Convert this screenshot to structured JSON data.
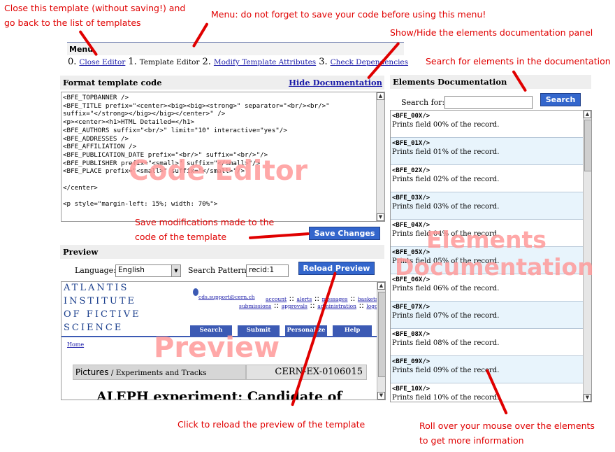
{
  "annotations": {
    "close_template": [
      "Close this template (without saving!) and",
      "go back to the list of templates"
    ],
    "menu_note": "Menu: do not forget to save your code before using this menu!",
    "show_hide_docs": "Show/Hide the elements documentation panel",
    "search_docs": "Search for elements in the documentation",
    "save_note": [
      "Save modifications made to the",
      "code of the template"
    ],
    "reload_note": "Click to reload the preview of the template",
    "rollover_note": [
      "Roll over your mouse over the elements",
      "to get more information"
    ],
    "code_editor_overlay": "Code Editor",
    "docs_overlay_1": "Elements",
    "docs_overlay_2": "Documentation",
    "preview_overlay": "Preview"
  },
  "menu": {
    "title": "Menu",
    "step0_num": "0.",
    "step0_link": "Close Editor",
    "step1_num": "1.",
    "step1_label": "Template Editor",
    "step2_num": "2.",
    "step2_link": "Modify Template Attributes",
    "step3_num": "3.",
    "step3_link": "Check Dependencies"
  },
  "editor": {
    "title": "Format template code",
    "hide_docs_link": "Hide Documentation",
    "code": "<BFE_TOPBANNER />\n<BFE_TITLE prefix=\"<center><big><big><strong>\" separator=\"<br/><br/>\"\nsuffix=\"</strong></big></big></center>\" />\n<p><center><h1>HTML Detailed=</h1>\n<BFE_AUTHORS suffix=\"<br/>\" limit=\"10\" interactive=\"yes\"/>\n<BFE_ADDRESSES />\n<BFE_AFFILIATION />\n<BFE_PUBLICATION_DATE prefix=\"<br/>\" suffix=\"<br/>\"/>\n<BFE_PUBLISHER prefix=\"<small>\" suffix=\"</small>\"/>\n<BFE_PLACE prefix=\"<small>\" suffix=\"</small>\"/>\n\n</center>\n\n<p style=\"margin-left: 15%; width: 70%\">",
    "save_button": "Save Changes"
  },
  "preview": {
    "title": "Preview",
    "language_label": "Language:",
    "language_value": "English",
    "pattern_label": "Search Pattern:",
    "pattern_value": "recid:1",
    "reload_button": "Reload Preview",
    "logo_lines": [
      "ATLANTIS",
      "INSTITUTE",
      "OF FICTIVE",
      "SCIENCE"
    ],
    "support_email": "cds.support@cern.ch",
    "top_links_1": [
      "account",
      "alerts",
      "messages",
      "baskets"
    ],
    "top_links_2": [
      "submissions",
      "approvals",
      "administration",
      "logout"
    ],
    "nav_buttons": [
      "Search",
      "Submit",
      "Personalize",
      "Help"
    ],
    "breadcrumb": "Home",
    "collection_label": "Pictures",
    "collection_sub": " / Experiments and Tracks",
    "record_id": "CERN-EX-0106015",
    "record_title": "ALEPH experiment: Candidate of"
  },
  "docs": {
    "title": "Elements Documentation",
    "search_label": "Search for:",
    "search_value": "",
    "search_button": "Search",
    "items": [
      {
        "tag": "<BFE_00X/>",
        "desc": "Prints field 00% of the record."
      },
      {
        "tag": "<BFE_01X/>",
        "desc": "Prints field 01% of the record."
      },
      {
        "tag": "<BFE_02X/>",
        "desc": "Prints field 02% of the record."
      },
      {
        "tag": "<BFE_03X/>",
        "desc": "Prints field 03% of the record."
      },
      {
        "tag": "<BFE_04X/>",
        "desc": "Prints field 04% of the record."
      },
      {
        "tag": "<BFE_05X/>",
        "desc": "Prints field 05% of the record."
      },
      {
        "tag": "<BFE_06X/>",
        "desc": "Prints field 06% of the record."
      },
      {
        "tag": "<BFE_07X/>",
        "desc": "Prints field 07% of the record."
      },
      {
        "tag": "<BFE_08X/>",
        "desc": "Prints field 08% of the record."
      },
      {
        "tag": "<BFE_09X/>",
        "desc": "Prints field 09% of the record."
      },
      {
        "tag": "<BFE_10X/>",
        "desc": "Prints field 10% of the record."
      }
    ]
  },
  "colors": {
    "annotation_red": "#e00000",
    "overlay_pink": "#ff9a9a",
    "button_blue": "#3366cc",
    "link_blue": "#1a1aa8",
    "row_highlight": "#e8f4fc"
  }
}
